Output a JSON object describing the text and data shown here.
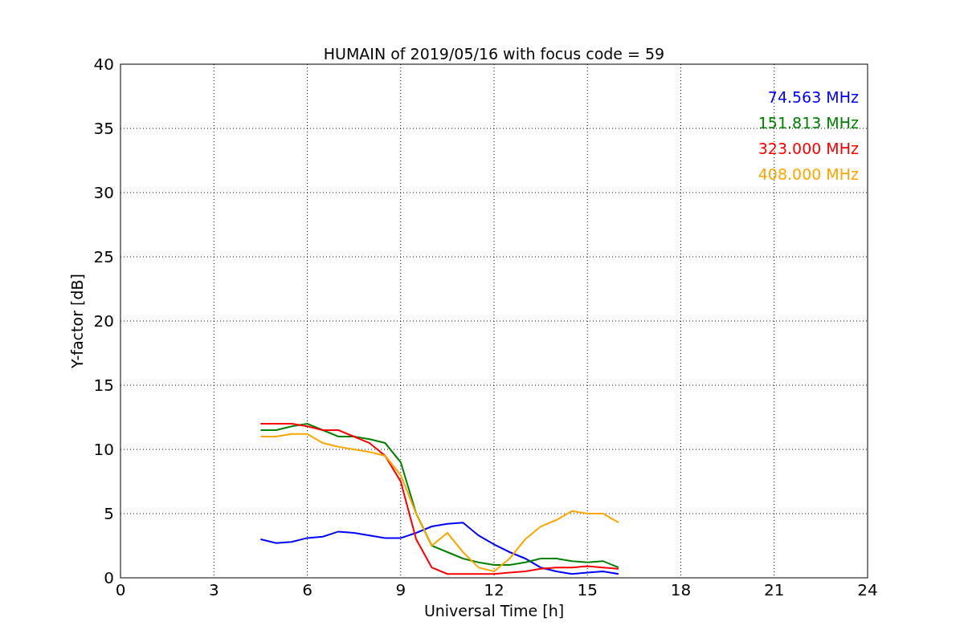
{
  "figure": {
    "chart_data": {
      "type": "line",
      "title": "HUMAIN of 2019/05/16 with focus code = 59",
      "xlabel": "Universal Time [h]",
      "ylabel": "Y-factor [dB]",
      "x": [
        4.5,
        5,
        5.5,
        6,
        6.5,
        7,
        7.5,
        8,
        8.5,
        9,
        9.5,
        10,
        10.5,
        11,
        11.5,
        12,
        12.5,
        13,
        13.5,
        14,
        14.5,
        15,
        15.5,
        16
      ],
      "series": [
        {
          "name": "74.563 MHz",
          "color": "#0000ff",
          "values": [
            3,
            2.7,
            2.8,
            3.1,
            3.2,
            3.6,
            3.5,
            3.3,
            3.1,
            3.1,
            3.5,
            4.0,
            4.2,
            4.3,
            3.3,
            2.6,
            2.0,
            1.5,
            0.8,
            0.5,
            0.3,
            0.4,
            0.5,
            0.3
          ]
        },
        {
          "name": "151.813 MHz",
          "color": "#008000",
          "values": [
            11.5,
            11.5,
            11.8,
            12,
            11.5,
            11,
            11,
            10.8,
            10.5,
            9,
            5,
            2.5,
            2,
            1.5,
            1.2,
            1.0,
            1.0,
            1.2,
            1.5,
            1.5,
            1.3,
            1.2,
            1.3,
            0.8
          ]
        },
        {
          "name": "323.000 MHz",
          "color": "#ff0000",
          "values": [
            12,
            12,
            12,
            11.8,
            11.5,
            11.5,
            11,
            10.5,
            9.5,
            7.5,
            3,
            0.8,
            0.3,
            0.3,
            0.3,
            0.3,
            0.4,
            0.5,
            0.7,
            0.8,
            0.8,
            0.9,
            0.8,
            0.7
          ]
        },
        {
          "name": "408.000 MHz",
          "color": "#ffa500",
          "values": [
            11,
            11,
            11.2,
            11.2,
            10.5,
            10.2,
            10,
            9.8,
            9.5,
            8,
            5,
            2.5,
            3.5,
            2,
            0.8,
            0.5,
            1.5,
            3,
            4,
            4.5,
            5.2,
            5,
            5,
            4.3
          ]
        }
      ],
      "grid": true,
      "xlim": [
        0,
        24
      ],
      "ylim": [
        0,
        40
      ],
      "xticks": [
        0,
        3,
        6,
        9,
        12,
        15,
        18,
        21,
        24
      ],
      "yticks": [
        0,
        5,
        10,
        15,
        20,
        25,
        30,
        35,
        40
      ]
    }
  }
}
